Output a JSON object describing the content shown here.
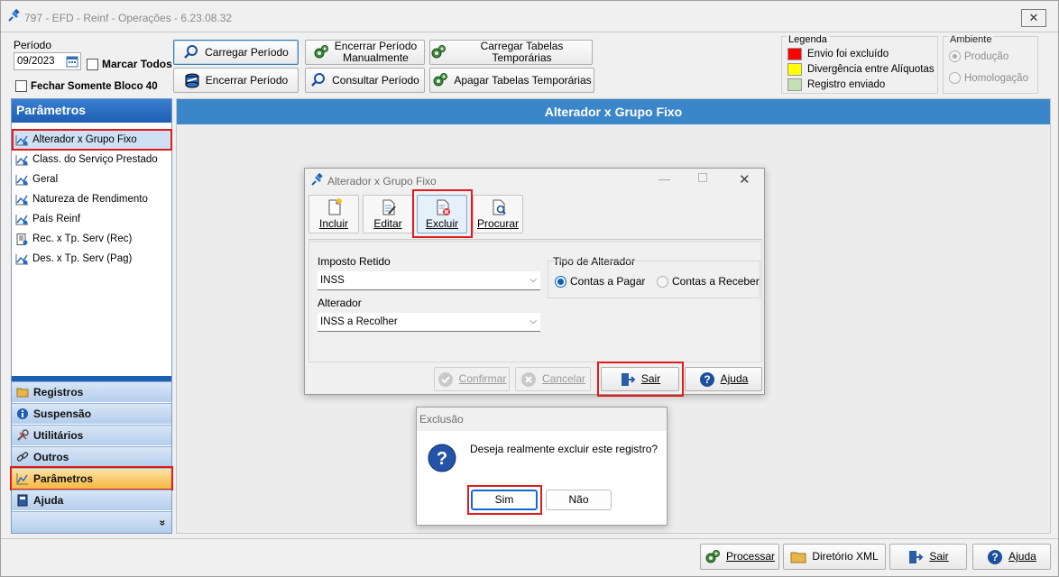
{
  "window": {
    "title": "797 - EFD - Reinf - Operações - 6.23.08.32",
    "close_glyph": "✕"
  },
  "toolbar": {
    "periodo_label": "Período",
    "periodo_value": "09/2023",
    "marcar_todos": "Marcar Todos",
    "fechar_bloco": "Fechar Somente Bloco 40",
    "carregar_periodo": "Carregar Período",
    "encerrar_periodo": "Encerrar Período",
    "encerrar_manual_l1": "Encerrar Período",
    "encerrar_manual_l2": "Manualmente",
    "consultar_periodo": "Consultar Período",
    "carregar_tabelas": "Carregar Tabelas Temporárias",
    "apagar_tabelas": "Apagar Tabelas Temporárias"
  },
  "legend": {
    "label": "Legenda",
    "items": [
      {
        "text": "Envio foi excluído",
        "color": "#ff0000"
      },
      {
        "text": "Divergência entre Alíquotas",
        "color": "#ffff00"
      },
      {
        "text": "Registro enviado",
        "color": "#c6dfb4"
      }
    ]
  },
  "ambiente": {
    "label": "Ambiente",
    "producao": "Produção",
    "homologacao": "Homologação"
  },
  "sidebar": {
    "header": "Parâmetros",
    "items": [
      {
        "label": "Alterador x Grupo Fixo"
      },
      {
        "label": "Class. do Serviço Prestado"
      },
      {
        "label": "Geral"
      },
      {
        "label": "Natureza de Rendimento"
      },
      {
        "label": "País Reinf"
      },
      {
        "label": "Rec. x Tp. Serv (Rec)"
      },
      {
        "label": "Des. x Tp. Serv (Pag)"
      }
    ],
    "nav": {
      "registros": "Registros",
      "suspensao": "Suspensão",
      "utilitarios": "Utilitários",
      "outros": "Outros",
      "parametros": "Parâmetros",
      "ajuda": "Ajuda",
      "more": "»"
    }
  },
  "main": {
    "header": "Alterador x Grupo Fixo"
  },
  "dialog": {
    "title": "Alterador x Grupo Fixo",
    "toolbar": {
      "incluir": "Incluir",
      "editar": "Editar",
      "excluir": "Excluir",
      "procurar": "Procurar"
    },
    "imposto_label": "Imposto Retido",
    "imposto_value": "INSS",
    "alterador_label": "Alterador",
    "alterador_value": "INSS a Recolher",
    "tipo_label": "Tipo de Alterador",
    "contas_pagar": "Contas a Pagar",
    "contas_receber": "Contas a Receber",
    "confirmar": "Confirmar",
    "cancelar": "Cancelar",
    "sair": "Sair",
    "ajuda": "Ajuda"
  },
  "confirm": {
    "title": "Exclusão",
    "message": "Deseja realmente excluir este registro?",
    "sim": "Sim",
    "nao": "Não"
  },
  "bottom": {
    "processar": "Processar",
    "diretorio": "Diretório XML",
    "sair": "Sair",
    "ajuda": "Ajuda"
  }
}
